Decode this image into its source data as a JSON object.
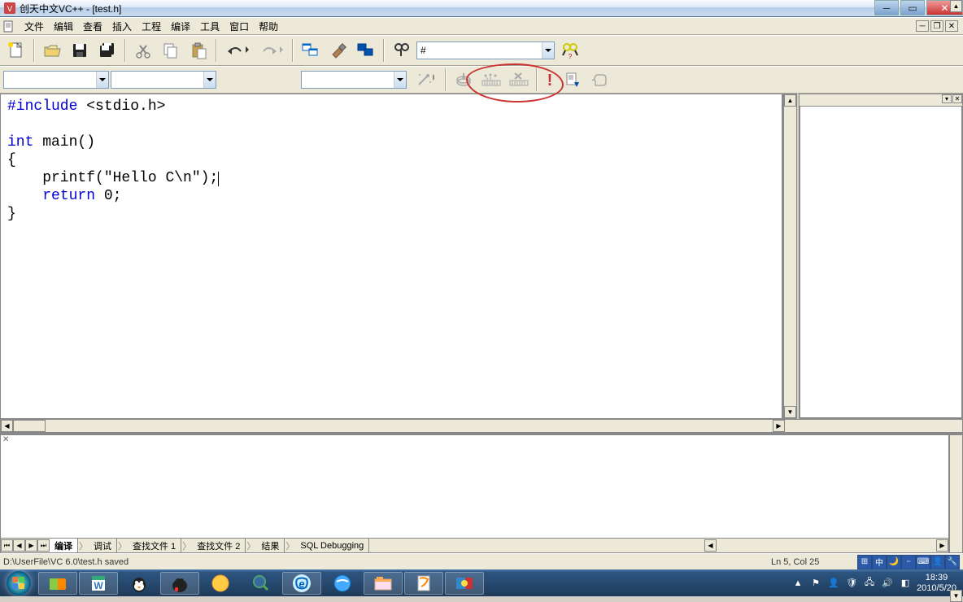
{
  "titlebar": {
    "app_title": "创天中文VC++ - [test.h]"
  },
  "menubar": {
    "items": [
      "文件",
      "编辑",
      "查看",
      "插入",
      "工程",
      "编译",
      "工具",
      "窗口",
      "帮助"
    ]
  },
  "toolbar": {
    "find_combo_value": "#"
  },
  "code": {
    "line1_kw": "#include",
    "line1_rest": " <stdio.h>",
    "line3_kw": "int",
    "line3_rest": " main()",
    "line4": "{",
    "line5_pre": "    printf(",
    "line5_str": "\"Hello C\\n\"",
    "line5_post": ");",
    "line6_pre": "    ",
    "line6_kw": "return",
    "line6_post": " 0;",
    "line7": "}"
  },
  "output_tabs": {
    "t1": "编译",
    "t2": "调试",
    "t3": "查找文件 1",
    "t4": "查找文件 2",
    "t5": "结果",
    "t6": "SQL Debugging"
  },
  "statusbar": {
    "message": "D:\\UserFile\\VC 6.0\\test.h saved",
    "position": "Ln 5, Col 25"
  },
  "tray": {
    "time": "18:39",
    "date": "2010/5/20",
    "ime": "中"
  }
}
